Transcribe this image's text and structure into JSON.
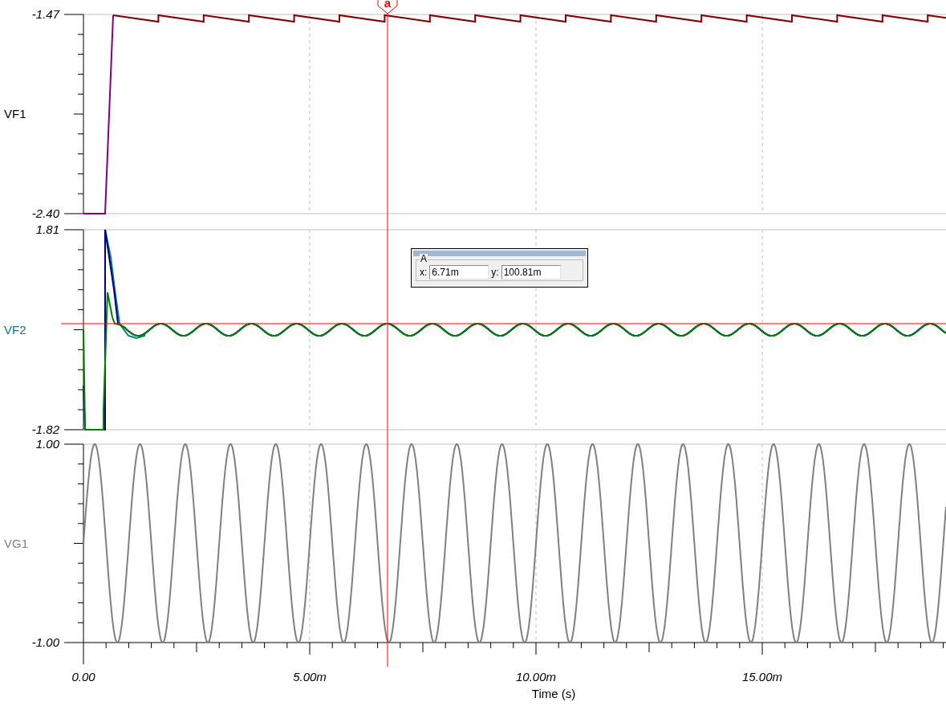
{
  "panels": [
    {
      "label": "VF1",
      "color": "#000000",
      "y_max": "-1.47",
      "y_min": "-2.40",
      "kind": "sawtooth"
    },
    {
      "label": "VF2",
      "color": "#008080",
      "y_max": "1.81",
      "y_min": "-1.82",
      "kind": "settling"
    },
    {
      "label": "VG1",
      "color": "#808080",
      "y_max": "1.00",
      "y_min": "-1.00",
      "kind": "sine"
    }
  ],
  "x_axis": {
    "ticks": [
      "0.00",
      "5.00m",
      "10.00m",
      "15.00m"
    ],
    "title": "Time (s)"
  },
  "cursor": {
    "label": "a"
  },
  "cursor_window": {
    "group": "A",
    "x_label": "x:",
    "x_value": "6.71m",
    "y_label": "y:",
    "y_value": "100.81m"
  }
}
